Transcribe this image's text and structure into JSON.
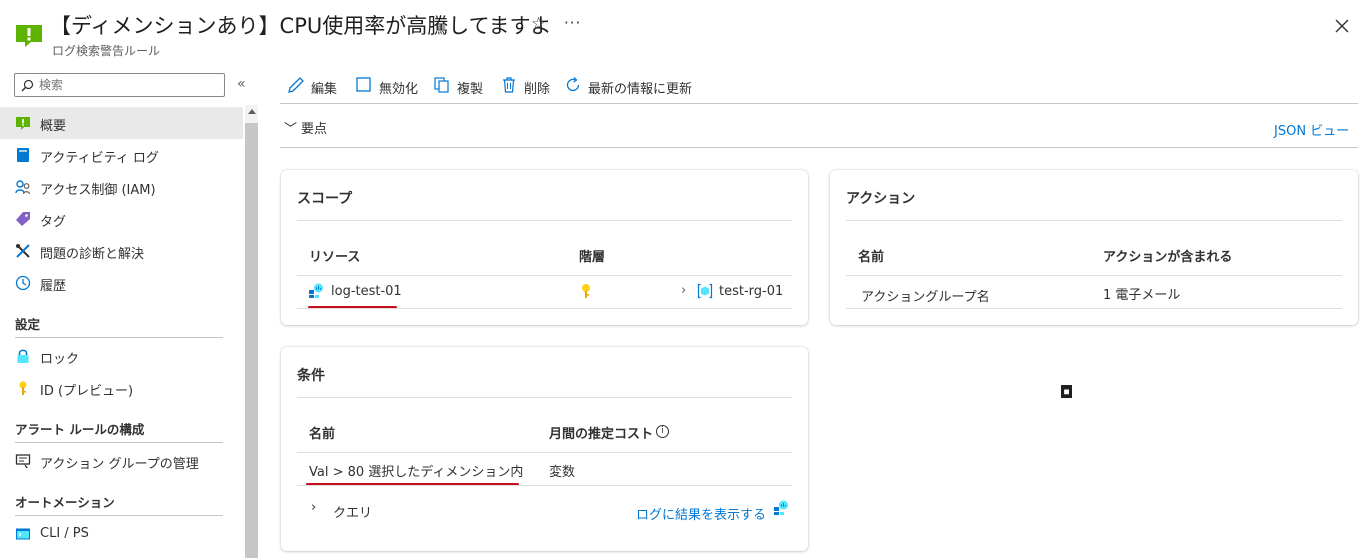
{
  "header": {
    "title": "【ディメンションあり】CPU使用率が高騰してますよ",
    "subtitle": "ログ検索警告ルール",
    "star_glyph": "☆",
    "more_glyph": "···",
    "brand_color": "#5db300"
  },
  "sidebar": {
    "search_placeholder": "検索",
    "collapse_glyph": "«",
    "items": [
      {
        "label": "概要",
        "icon": "overview-icon",
        "active": true
      },
      {
        "label": "アクティビティ ログ",
        "icon": "activity-log-icon"
      },
      {
        "label": "アクセス制御 (IAM)",
        "icon": "iam-icon"
      },
      {
        "label": "タグ",
        "icon": "tag-icon"
      },
      {
        "label": "問題の診断と解決",
        "icon": "diagnose-icon"
      },
      {
        "label": "履歴",
        "icon": "history-icon"
      }
    ],
    "sections": [
      {
        "title": "設定",
        "items": [
          {
            "label": "ロック",
            "icon": "lock-icon"
          },
          {
            "label": "ID (プレビュー)",
            "icon": "key-icon"
          }
        ]
      },
      {
        "title": "アラート ルールの構成",
        "items": [
          {
            "label": "アクション グループの管理",
            "icon": "action-group-icon"
          }
        ]
      },
      {
        "title": "オートメーション",
        "items": [
          {
            "label": "CLI / PS",
            "icon": "cli-icon"
          }
        ]
      }
    ]
  },
  "toolbar": {
    "edit": "編集",
    "disable": "無効化",
    "duplicate": "複製",
    "delete": "削除",
    "refresh": "最新の情報に更新"
  },
  "essentials": {
    "label": "要点",
    "json_view": "JSON ビュー"
  },
  "scope_card": {
    "title": "スコープ",
    "col_resource": "リソース",
    "col_hierarchy": "階層",
    "resource": "log-test-01",
    "resource_group": "test-rg-01"
  },
  "action_card": {
    "title": "アクション",
    "col_name": "名前",
    "col_included": "アクションが含まれる",
    "row_name": "アクショングループ名",
    "row_included": "1 電子メール"
  },
  "condition_card": {
    "title": "条件",
    "col_name": "名前",
    "col_cost": "月間の推定コスト",
    "info_glyph": "i",
    "row_name": "Val > 80 選択したディメンション内",
    "row_cost": "変数",
    "query_label": "クエリ",
    "show_results": "ログに結果を表示する"
  },
  "badge_text": "■"
}
